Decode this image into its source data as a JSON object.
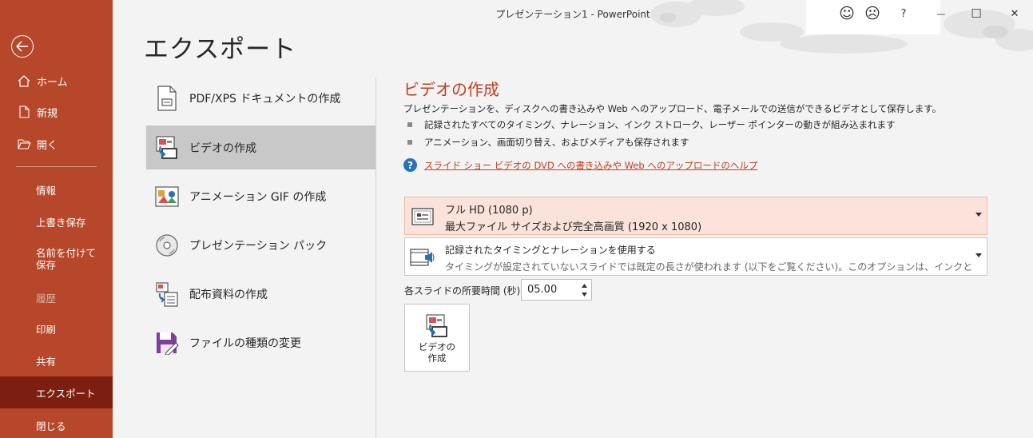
{
  "window": {
    "title": "プレゼンテーション1 - PowerPoint",
    "buttons": {
      "smile": "☺",
      "frown": "☹",
      "help": "?",
      "minimize": "—",
      "restore": "☐",
      "close": "✕"
    }
  },
  "nav": {
    "top_items": [
      {
        "label": "ホーム",
        "icon": "home-icon"
      },
      {
        "label": "新規",
        "icon": "new-document-icon"
      },
      {
        "label": "開く",
        "icon": "open-folder-icon"
      }
    ],
    "items": [
      {
        "label": "情報"
      },
      {
        "label": "上書き保存"
      },
      {
        "label": "名前を付けて保存"
      },
      {
        "label": "履歴"
      },
      {
        "label": "印刷"
      },
      {
        "label": "共有"
      },
      {
        "label": "エクスポート"
      },
      {
        "label": "閉じる"
      }
    ]
  },
  "page_title": "エクスポート",
  "options": [
    {
      "label": "PDF/XPS ドキュメントの作成",
      "icon": "pdf-document-icon"
    },
    {
      "label": "ビデオの作成",
      "icon": "video-icon"
    },
    {
      "label": "アニメーション GIF の作成",
      "icon": "gif-image-icon"
    },
    {
      "label": "プレゼンテーション パック",
      "icon": "cd-package-icon"
    },
    {
      "label": "配布資料の作成",
      "icon": "handout-icon"
    },
    {
      "label": "ファイルの種類の変更",
      "icon": "file-type-icon"
    }
  ],
  "panel": {
    "title": "ビデオの作成",
    "description": "プレゼンテーションを、ディスクへの書き込みや Web へのアップロード、電子メールでの送信ができるビデオとして保存します。",
    "bullets": [
      "記録されたすべてのタイミング、ナレーション、インク ストローク、レーザー ポインターの動きが組み込まれます",
      "アニメーション、画面切り替え、およびメディアも保存されます"
    ],
    "help_link": "スライド ショー ビデオの DVD への書き込みや Web へのアップロードのヘルプ",
    "quality": {
      "line1": "フル HD (1080 p)",
      "line2": "最大ファイル サイズおよび完全高画質 (1920 x 1080)"
    },
    "timing": {
      "line1": "記録されたタイミングとナレーションを使用する",
      "line2": "タイミングが設定されていないスライドでは既定の長さが使われます (以下をご覧ください)。このオプションは、インクとレーザー ポイ..."
    },
    "duration_label": "各スライドの所要時間 (秒):",
    "duration_value": "05.00",
    "create_button": {
      "line1": "ビデオの",
      "line2": "作成"
    }
  },
  "colors": {
    "accent": "#b7472a",
    "nav_selected": "#7d1f10",
    "title_accent": "#c43e1c",
    "selected_option": "#c8c8c8"
  }
}
